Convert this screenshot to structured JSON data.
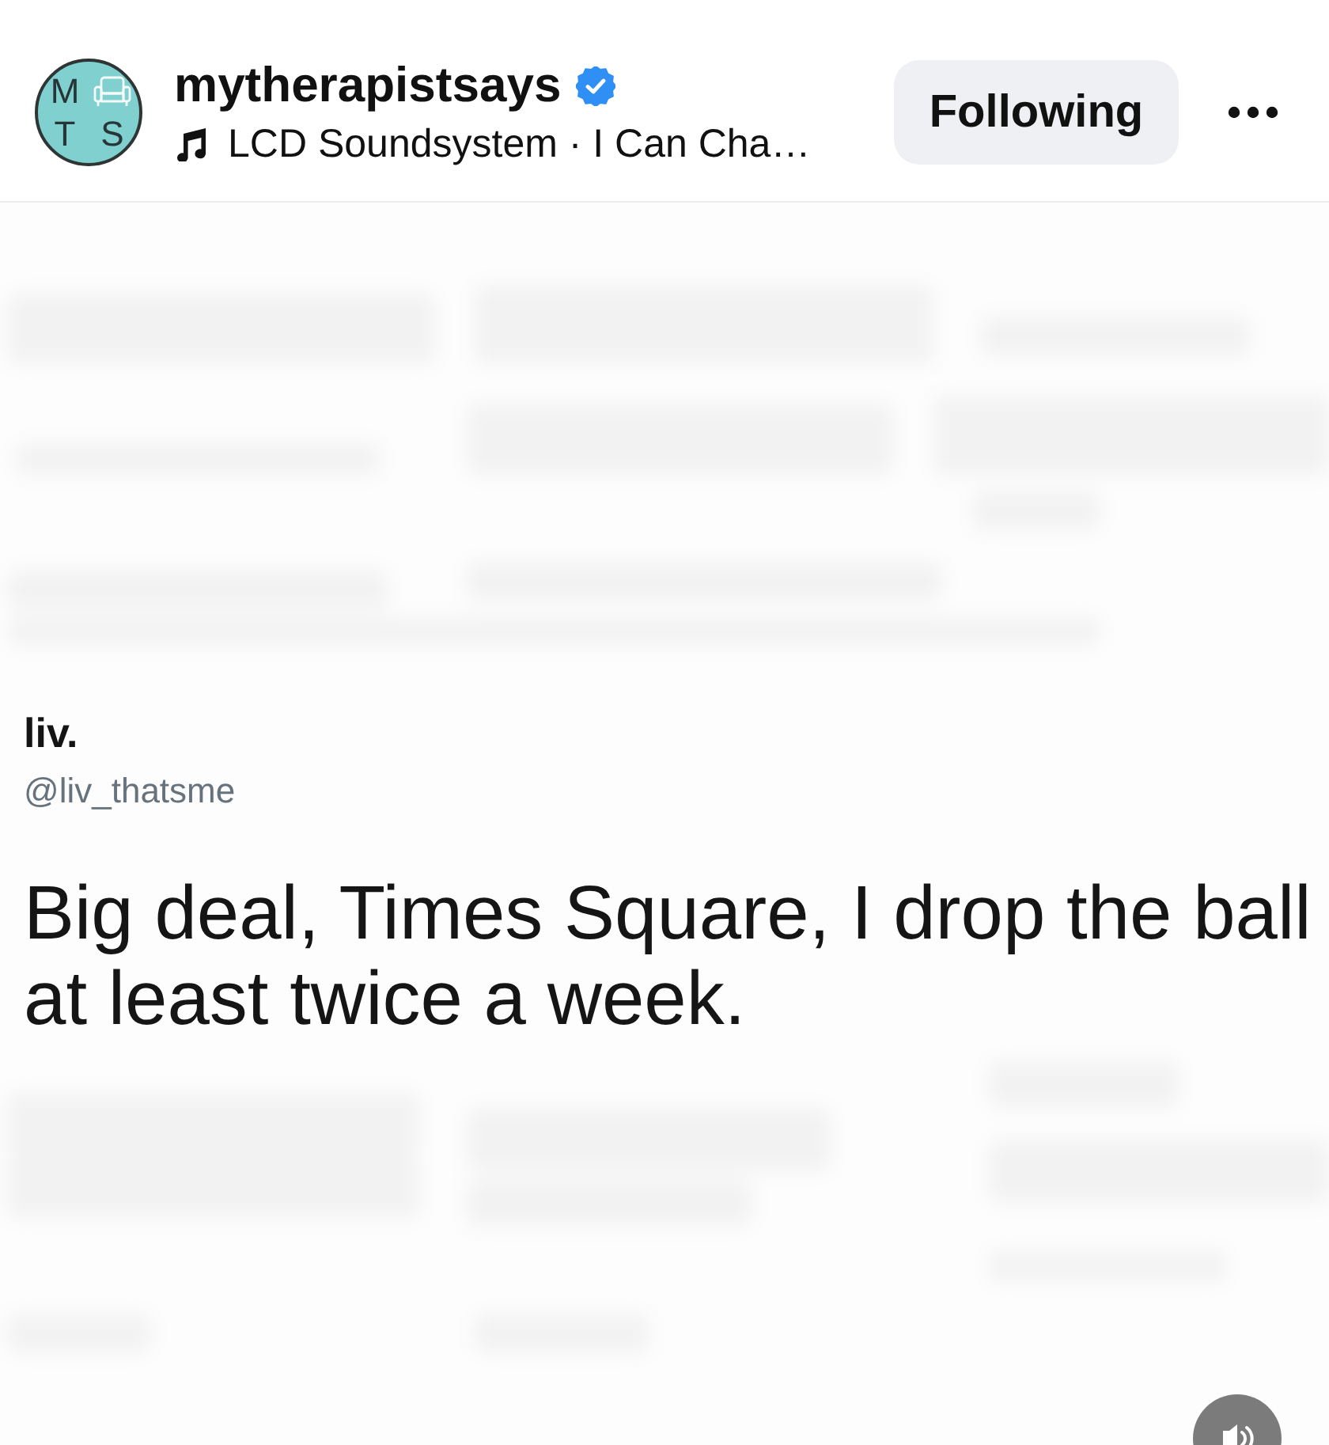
{
  "header": {
    "avatar": {
      "letters": [
        "M",
        "T",
        "S"
      ]
    },
    "username": "mytherapistsays",
    "verified": true,
    "audio": "LCD Soundsystem · I Can Cha…",
    "follow_button": "Following"
  },
  "media": {
    "tweet": {
      "name": "liv.",
      "handle": "@liv_thatsme",
      "text": "Big deal, Times Square, I drop the ball at least twice a week."
    },
    "muted": false
  }
}
